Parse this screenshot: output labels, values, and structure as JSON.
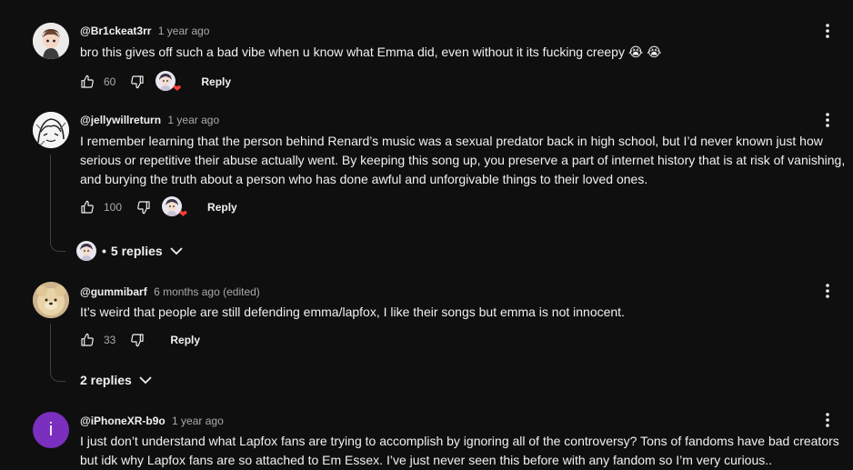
{
  "comments": [
    {
      "handle": "@Br1ckeat3rr",
      "time": "1 year ago",
      "lines": [
        "bro this gives off such a bad vibe when u know what Emma did, even without it its fucking creepy 😭 😭"
      ],
      "likes": "60",
      "reply_label": "Reply"
    },
    {
      "handle": "@jellywillreturn",
      "time": "1 year ago",
      "lines": [
        "I remember learning that the person behind Renard’s music was a sexual predator back in high school, but I’d never known just how",
        "serious or repetitive their abuse actually went. By keeping this song up, you preserve a part of internet history that is at risk of vanishing,",
        "and burying the truth about a person who has done awful and unforgivable things to their loved ones."
      ],
      "likes": "100",
      "reply_label": "Reply",
      "replies_label": "5 replies",
      "replies_bullet": "•"
    },
    {
      "handle": "@gummibarf",
      "time": "6 months ago (edited)",
      "lines": [
        "It’s weird that people are still defending emma/lapfox, I like their songs but emma is not innocent."
      ],
      "likes": "33",
      "reply_label": "Reply",
      "replies_label": "2 replies"
    },
    {
      "handle": "@iPhoneXR-b9o",
      "time": "1 year ago",
      "avatar_letter": "i",
      "lines": [
        "I just don’t understand what Lapfox fans are trying to accomplish by ignoring all of the controversy? Tons of fandoms have bad creators",
        "but idk why Lapfox fans are so attached to Em Essex. I’ve just never seen this before with any fandom so I’m very curious.."
      ]
    }
  ],
  "icons": {
    "like": "thumb-up-icon",
    "dislike": "thumb-down-icon",
    "more": "more-vert-icon",
    "chevron": "chevron-down-icon",
    "heart": "heart-icon"
  },
  "colors": {
    "background": "#0f0f0f",
    "text": "#f1f1f1",
    "secondary": "#aaaaaa",
    "heart": "#ff3b3b",
    "purple_avatar": "#7b2fbe"
  }
}
